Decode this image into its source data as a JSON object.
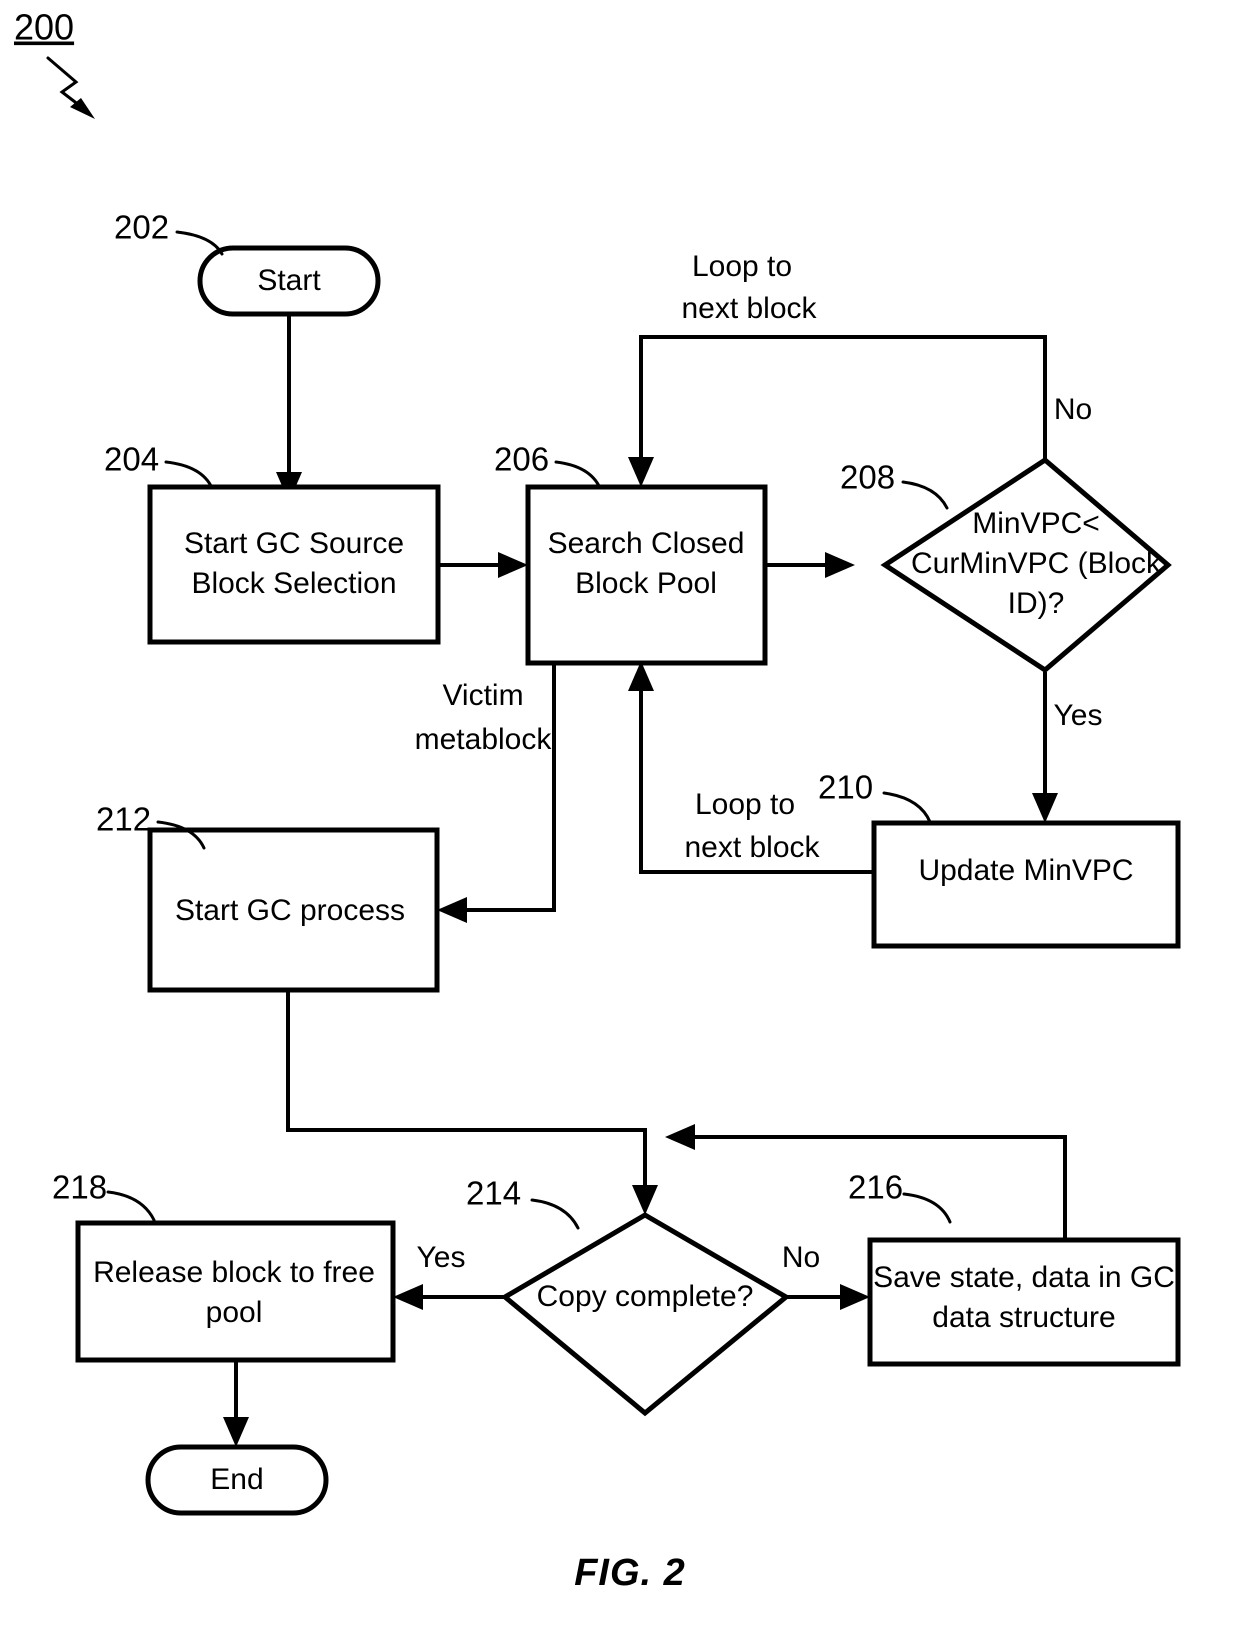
{
  "figure": {
    "diagram_number": "200",
    "caption": "FIG. 2"
  },
  "nodes": {
    "start": {
      "ref": "202",
      "label": "Start",
      "shape": "terminator"
    },
    "gc_source": {
      "ref": "204",
      "line1": "Start GC Source",
      "line2": "Block Selection",
      "shape": "process"
    },
    "search_pool": {
      "ref": "206",
      "line1": "Search Closed",
      "line2": "Block Pool",
      "shape": "process"
    },
    "minvpc_decision": {
      "ref": "208",
      "line1": "MinVPC<",
      "line2": "CurMinVPC (Block",
      "line3": "ID)?",
      "shape": "decision"
    },
    "update_minvpc": {
      "ref": "210",
      "line1": "Update MinVPC",
      "shape": "process"
    },
    "start_gc_process": {
      "ref": "212",
      "line1": "Start GC process",
      "shape": "process"
    },
    "copy_complete": {
      "ref": "214",
      "line1": "Copy complete?",
      "shape": "decision"
    },
    "save_state": {
      "ref": "216",
      "line1": "Save state, data in GC",
      "line2": "data structure",
      "shape": "process"
    },
    "release_block": {
      "ref": "218",
      "line1": "Release block to free",
      "line2": "pool",
      "shape": "process"
    },
    "end": {
      "label": "End",
      "shape": "terminator"
    }
  },
  "edge_labels": {
    "loop_top_1": "Loop to",
    "loop_top_2": "next block",
    "no_upper": "No",
    "yes_upper": "Yes",
    "loop_lower_1": "Loop to",
    "loop_lower_2": "next block",
    "victim_1": "Victim",
    "victim_2": "metablock",
    "yes_lower": "Yes",
    "no_lower": "No"
  },
  "chart_data": {
    "type": "flowchart",
    "title": "FIG. 2",
    "diagram_id": "200",
    "steps": [
      {
        "id": "202",
        "text": "Start",
        "type": "terminator"
      },
      {
        "id": "204",
        "text": "Start GC Source Block Selection",
        "type": "process"
      },
      {
        "id": "206",
        "text": "Search Closed Block Pool",
        "type": "process"
      },
      {
        "id": "208",
        "text": "MinVPC< CurMinVPC (Block ID)?",
        "type": "decision"
      },
      {
        "id": "210",
        "text": "Update MinVPC",
        "type": "process"
      },
      {
        "id": "212",
        "text": "Start GC process",
        "type": "process"
      },
      {
        "id": "214",
        "text": "Copy complete?",
        "type": "decision"
      },
      {
        "id": "216",
        "text": "Save state, data in GC data structure",
        "type": "process"
      },
      {
        "id": "218",
        "text": "Release block to free pool",
        "type": "process"
      },
      {
        "id": "end",
        "text": "End",
        "type": "terminator"
      }
    ],
    "edges": [
      {
        "from": "202",
        "to": "204",
        "label": ""
      },
      {
        "from": "204",
        "to": "206",
        "label": ""
      },
      {
        "from": "206",
        "to": "208",
        "label": ""
      },
      {
        "from": "208",
        "to": "206",
        "label": "Loop to next block"
      },
      {
        "from": "208",
        "to": "210",
        "label": "Yes"
      },
      {
        "from": "210",
        "to": "206",
        "label": "Loop to next block"
      },
      {
        "from": "206",
        "to": "212",
        "label": "Victim metablock"
      },
      {
        "from": "212",
        "to": "214",
        "label": ""
      },
      {
        "from": "214",
        "to": "218",
        "label": "Yes"
      },
      {
        "from": "214",
        "to": "216",
        "label": "No"
      },
      {
        "from": "216",
        "to": "214",
        "label": ""
      },
      {
        "from": "218",
        "to": "end",
        "label": ""
      }
    ]
  }
}
